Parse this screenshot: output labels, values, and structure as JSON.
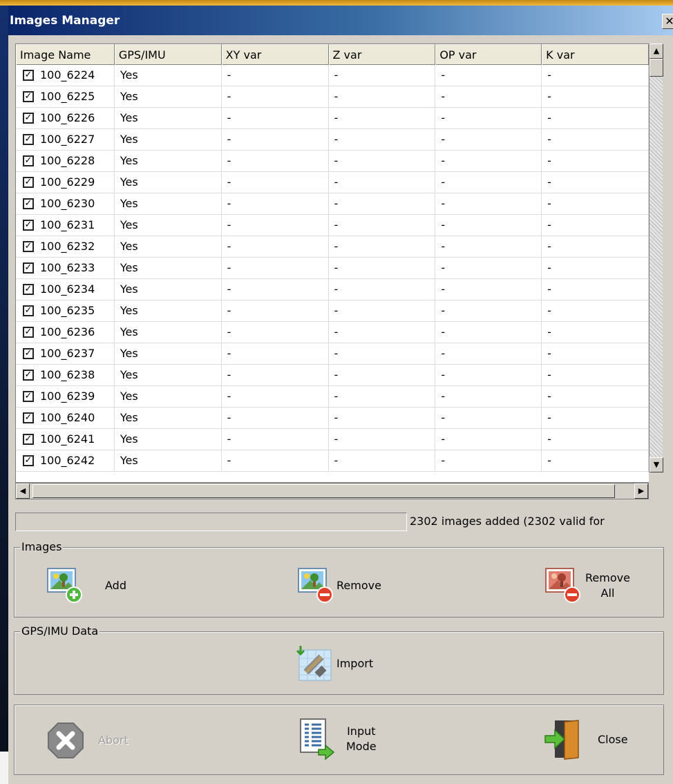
{
  "window": {
    "title": "Images Manager",
    "close_glyph": "✕"
  },
  "grid": {
    "columns": [
      "Image Name",
      "GPS/IMU",
      "XY var",
      "Z var",
      "OP var",
      "K var"
    ],
    "rows": [
      {
        "name": "100_6224",
        "gps": "Yes",
        "xy": "-",
        "z": "-",
        "op": "-",
        "k": "-"
      },
      {
        "name": "100_6225",
        "gps": "Yes",
        "xy": "-",
        "z": "-",
        "op": "-",
        "k": "-"
      },
      {
        "name": "100_6226",
        "gps": "Yes",
        "xy": "-",
        "z": "-",
        "op": "-",
        "k": "-"
      },
      {
        "name": "100_6227",
        "gps": "Yes",
        "xy": "-",
        "z": "-",
        "op": "-",
        "k": "-"
      },
      {
        "name": "100_6228",
        "gps": "Yes",
        "xy": "-",
        "z": "-",
        "op": "-",
        "k": "-"
      },
      {
        "name": "100_6229",
        "gps": "Yes",
        "xy": "-",
        "z": "-",
        "op": "-",
        "k": "-"
      },
      {
        "name": "100_6230",
        "gps": "Yes",
        "xy": "-",
        "z": "-",
        "op": "-",
        "k": "-"
      },
      {
        "name": "100_6231",
        "gps": "Yes",
        "xy": "-",
        "z": "-",
        "op": "-",
        "k": "-"
      },
      {
        "name": "100_6232",
        "gps": "Yes",
        "xy": "-",
        "z": "-",
        "op": "-",
        "k": "-"
      },
      {
        "name": "100_6233",
        "gps": "Yes",
        "xy": "-",
        "z": "-",
        "op": "-",
        "k": "-"
      },
      {
        "name": "100_6234",
        "gps": "Yes",
        "xy": "-",
        "z": "-",
        "op": "-",
        "k": "-"
      },
      {
        "name": "100_6235",
        "gps": "Yes",
        "xy": "-",
        "z": "-",
        "op": "-",
        "k": "-"
      },
      {
        "name": "100_6236",
        "gps": "Yes",
        "xy": "-",
        "z": "-",
        "op": "-",
        "k": "-"
      },
      {
        "name": "100_6237",
        "gps": "Yes",
        "xy": "-",
        "z": "-",
        "op": "-",
        "k": "-"
      },
      {
        "name": "100_6238",
        "gps": "Yes",
        "xy": "-",
        "z": "-",
        "op": "-",
        "k": "-"
      },
      {
        "name": "100_6239",
        "gps": "Yes",
        "xy": "-",
        "z": "-",
        "op": "-",
        "k": "-"
      },
      {
        "name": "100_6240",
        "gps": "Yes",
        "xy": "-",
        "z": "-",
        "op": "-",
        "k": "-"
      },
      {
        "name": "100_6241",
        "gps": "Yes",
        "xy": "-",
        "z": "-",
        "op": "-",
        "k": "-"
      },
      {
        "name": "100_6242",
        "gps": "Yes",
        "xy": "-",
        "z": "-",
        "op": "-",
        "k": "-"
      }
    ],
    "checked": true
  },
  "status": {
    "text": "2302 images added (2302 valid for",
    "progress": 0
  },
  "images_group": {
    "legend": "Images",
    "add_label": "Add",
    "remove_label": "Remove",
    "remove_all_label_1": "Remove",
    "remove_all_label_2": "All"
  },
  "gps_group": {
    "legend": "GPS/IMU Data",
    "import_label": "Import"
  },
  "footer": {
    "abort_label": "Abort",
    "input_mode_label_1": "Input",
    "input_mode_label_2": "Mode",
    "close_label": "Close"
  },
  "icons": {
    "add": "image-add-icon",
    "remove": "image-remove-icon",
    "remove_all": "image-remove-all-icon",
    "import": "satellite-import-icon",
    "abort": "abort-icon",
    "input_mode": "input-mode-icon",
    "close": "exit-door-icon"
  }
}
